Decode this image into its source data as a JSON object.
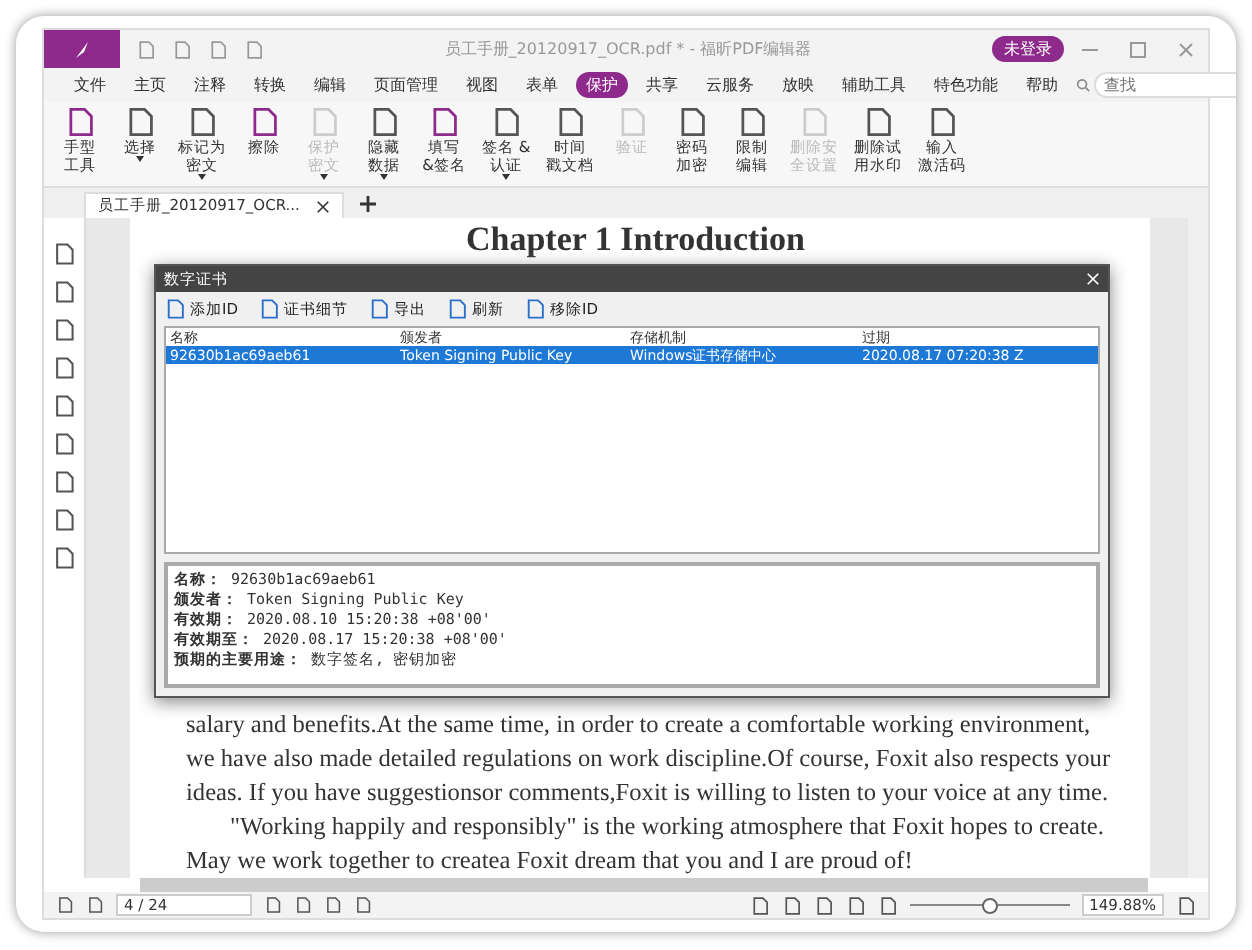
{
  "window": {
    "title": "员工手册_20120917_OCR.pdf * - 福昕PDF编辑器",
    "user": "未登录"
  },
  "menu": [
    {
      "label": "文件",
      "selected": false
    },
    {
      "label": "主页",
      "selected": false
    },
    {
      "label": "注释",
      "selected": false
    },
    {
      "label": "转换",
      "selected": false
    },
    {
      "label": "编辑",
      "selected": false
    },
    {
      "label": "页面管理",
      "selected": false
    },
    {
      "label": "视图",
      "selected": false
    },
    {
      "label": "表单",
      "selected": false
    },
    {
      "label": "保护",
      "selected": true
    },
    {
      "label": "共享",
      "selected": false
    },
    {
      "label": "云服务",
      "selected": false
    },
    {
      "label": "放映",
      "selected": false
    },
    {
      "label": "辅助工具",
      "selected": false
    },
    {
      "label": "特色功能",
      "selected": false
    },
    {
      "label": "帮助",
      "selected": false
    }
  ],
  "search": {
    "placeholder": "查找"
  },
  "ribbon": [
    {
      "lines": [
        "手型",
        "工具"
      ],
      "disabled": false,
      "dropdown": false
    },
    {
      "lines": [
        "选择"
      ],
      "disabled": false,
      "dropdown": true
    },
    {
      "lines": [
        "标记为",
        "密文"
      ],
      "disabled": false,
      "dropdown": true
    },
    {
      "lines": [
        "擦除"
      ],
      "disabled": false,
      "dropdown": false
    },
    {
      "lines": [
        "保护",
        "密文"
      ],
      "disabled": true,
      "dropdown": true
    },
    {
      "lines": [
        "隐藏",
        "数据"
      ],
      "disabled": false,
      "dropdown": true
    },
    {
      "lines": [
        "填写",
        "&签名"
      ],
      "disabled": false,
      "dropdown": false
    },
    {
      "lines": [
        "签名 &",
        "认证"
      ],
      "disabled": false,
      "dropdown": true
    },
    {
      "lines": [
        "时间",
        "戳文档"
      ],
      "disabled": false,
      "dropdown": false
    },
    {
      "lines": [
        "验证"
      ],
      "disabled": true,
      "dropdown": false
    },
    {
      "lines": [
        "密码",
        "加密"
      ],
      "disabled": false,
      "dropdown": false
    },
    {
      "lines": [
        "限制",
        "编辑"
      ],
      "disabled": false,
      "dropdown": false
    },
    {
      "lines": [
        "删除安",
        "全设置"
      ],
      "disabled": true,
      "dropdown": false
    },
    {
      "lines": [
        "删除试",
        "用水印"
      ],
      "disabled": false,
      "dropdown": false
    },
    {
      "lines": [
        "输入",
        "激活码"
      ],
      "disabled": false,
      "dropdown": false
    }
  ],
  "doc_tab": {
    "label": "员工手册_20120917_OCR...",
    "selected": true
  },
  "page": {
    "heading": "Chapter 1 Introduction",
    "lines": [
      "salary and benefits.At the same time, in order to create a comfortable working environment,",
      "we have also made detailed regulations on work discipline.Of course, Foxit also respects your",
      "ideas. If you have suggestionsor comments,Foxit is willing to listen to your voice at any time.",
      "\"Working happily and responsibly\" is the working atmosphere that Foxit hopes to create.",
      "May we work together to createa Foxit dream that you and I are proud of!"
    ]
  },
  "dialog": {
    "title": "数字证书",
    "toolbar": [
      "添加ID",
      "证书细节",
      "导出",
      "刷新",
      "移除ID"
    ],
    "columns": [
      "名称",
      "颁发者",
      "存储机制",
      "过期"
    ],
    "rows": [
      {
        "cells": [
          "92630b1ac69aeb61",
          "Token Signing Public Key",
          "Windows证书存储中心",
          "2020.08.17 07:20:38 Z"
        ],
        "selected": true
      }
    ],
    "details": [
      {
        "label": "名称：",
        "value": "92630b1ac69aeb61"
      },
      {
        "label": "颁发者：",
        "value": "Token Signing Public Key"
      },
      {
        "label": "有效期：",
        "value": "2020.08.10 15:20:38 +08'00'"
      },
      {
        "label": "有效期至：",
        "value": "2020.08.17 15:20:38 +08'00'"
      },
      {
        "label": "预期的主要用途：",
        "value": "数字签名, 密钥加密"
      }
    ]
  },
  "status_bar": {
    "page": "4 / 24",
    "zoom": "149.88%",
    "zoom_slider": {
      "level": 0.5
    }
  }
}
